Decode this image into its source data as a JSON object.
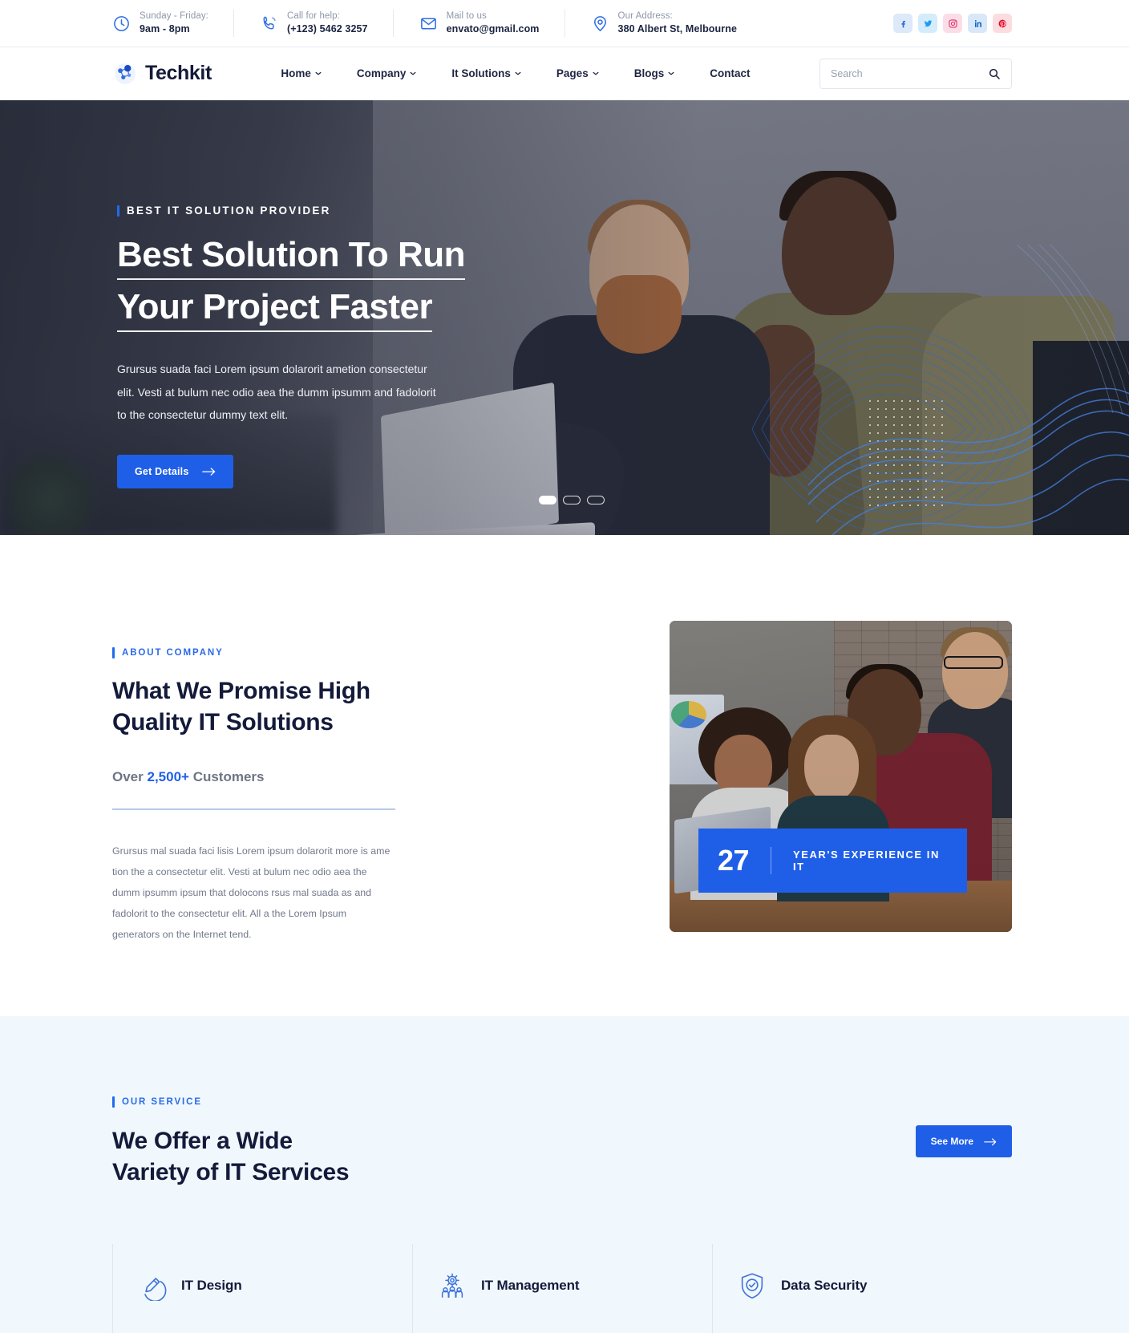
{
  "topbar": {
    "infos": [
      {
        "icon": "clock-icon",
        "label": "Sunday - Friday:",
        "value": "9am - 8pm"
      },
      {
        "icon": "phone-icon",
        "label": "Call for help:",
        "value": "(+123) 5462 3257"
      },
      {
        "icon": "mail-icon",
        "label": "Mail to us",
        "value": "envato@gmail.com"
      },
      {
        "icon": "location-icon",
        "label": "Our Address:",
        "value": "380 Albert St, Melbourne"
      }
    ],
    "socials": [
      {
        "name": "facebook-icon",
        "label": "f",
        "color": "#2b6fd6",
        "bg": "#dde9f9"
      },
      {
        "name": "twitter-icon",
        "label": "t",
        "color": "#1d9bf0",
        "bg": "#d4ecfb"
      },
      {
        "name": "instagram-icon",
        "label": "ig",
        "color": "#e1306c",
        "bg": "#fbdde8"
      },
      {
        "name": "linkedin-icon",
        "label": "in",
        "color": "#0a66c2",
        "bg": "#d8e8f8"
      },
      {
        "name": "pinterest-icon",
        "label": "p",
        "color": "#e60023",
        "bg": "#fbdcdf"
      }
    ]
  },
  "header": {
    "brand": "Techkit",
    "nav": [
      {
        "label": "Home",
        "has_dropdown": true
      },
      {
        "label": "Company",
        "has_dropdown": true
      },
      {
        "label": "It Solutions",
        "has_dropdown": true
      },
      {
        "label": "Pages",
        "has_dropdown": true
      },
      {
        "label": "Blogs",
        "has_dropdown": true
      },
      {
        "label": "Contact",
        "has_dropdown": false
      }
    ],
    "search": {
      "placeholder": "Search",
      "value": ""
    }
  },
  "hero": {
    "eyebrow": "BEST IT SOLUTION PROVIDER",
    "title_line1": "Best Solution To Run",
    "title_line2": "Your Project Faster",
    "paragraph": "Grursus suada faci Lorem ipsum dolarorit ametion consectetur elit. Vesti at bulum nec odio aea the dumm ipsumm and fadolorit to the consectetur dummy text elit.",
    "cta": "Get Details",
    "slides_total": 3,
    "active_slide": 1
  },
  "about": {
    "eyebrow": "ABOUT COMPANY",
    "title_line1": "What We Promise High",
    "title_line2": "Quality IT Solutions",
    "customers_pre": "Over ",
    "customers_count": "2,500+",
    "customers_post": " Customers",
    "paragraph": "Grursus mal suada faci lisis Lorem ipsum dolarorit more is ame tion the a consectetur elit. Vesti at bulum nec odio aea the dumm ipsumm ipsum that dolocons rsus mal suada as and fadolorit to the consectetur elit. All a the Lorem Ipsum generators on the Internet tend.",
    "badge_number": "27",
    "badge_label": "YEAR'S EXPERIENCE IN IT"
  },
  "service": {
    "eyebrow": "OUR SERVICE",
    "title_line1": "We Offer a Wide",
    "title_line2": "Variety of IT Services",
    "see_more": "See More",
    "cards": [
      {
        "icon": "pencil-circle-icon",
        "title": "IT Design"
      },
      {
        "icon": "gear-people-icon",
        "title": "IT Management"
      },
      {
        "icon": "shield-check-icon",
        "title": "Data Security"
      }
    ]
  },
  "colors": {
    "accent": "#1f5fe8",
    "dark": "#141a3a",
    "section_bg": "#f0f8fd"
  }
}
